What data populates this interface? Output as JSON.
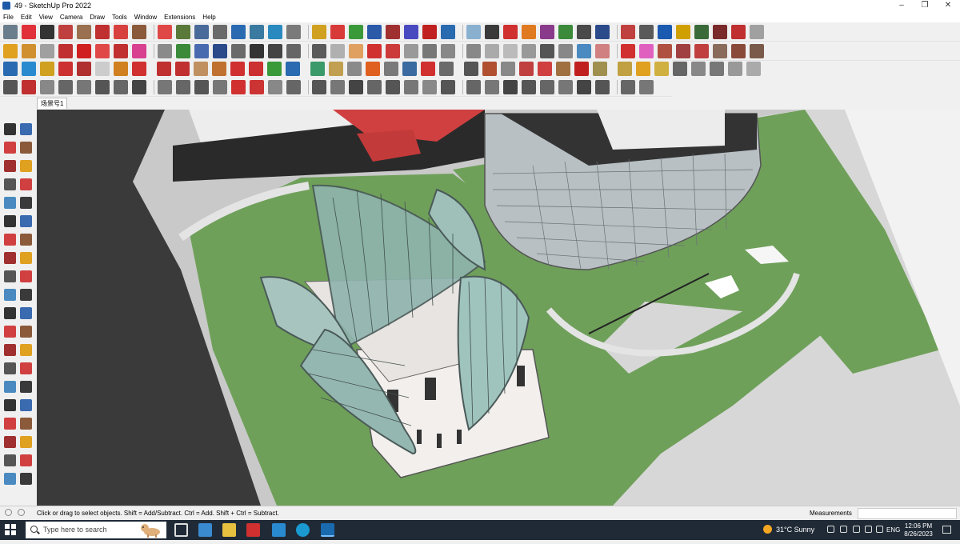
{
  "window": {
    "title": "49 - SketchUp Pro 2022",
    "minimize_glyph": "–",
    "maximize_glyph": "❐",
    "close_glyph": "✕"
  },
  "menu": [
    "File",
    "Edit",
    "View",
    "Camera",
    "Draw",
    "Tools",
    "Window",
    "Extensions",
    "Help"
  ],
  "scene_tab": "场景号1",
  "toolbar_rows": [
    {
      "count": 40,
      "colors": [
        "#6a7d8c",
        "#e0303a",
        "#333333",
        "#c04040",
        "#9a7050",
        "#c03030",
        "#d84040",
        "#8a5a3a",
        "#e04848",
        "#5a7a3a",
        "#4a6a9a",
        "#6a6a6a",
        "#2a6ab0",
        "#3a7aa0",
        "#2a8ac0",
        "#7a7a7a",
        "#d0a020",
        "#d83a3a",
        "#3a9a3a",
        "#2a5aa8",
        "#a03030",
        "#4a4ac0",
        "#c02020",
        "#2a6ab0",
        "#8ab0d0",
        "#3a3a3a",
        "#d03030",
        "#e07a20",
        "#8a3a8a",
        "#3a8a3a",
        "#4a4a4a",
        "#2a4a8a",
        "#c04040",
        "#5a5a5a",
        "#1a5ab0",
        "#d0a000",
        "#3a6a3a",
        "#7a2a2a",
        "#c03030",
        "#a0a0a0"
      ]
    },
    {
      "count": 40,
      "colors": [
        "#e0a020",
        "#d09030",
        "#a0a0a0",
        "#c03030",
        "#d02020",
        "#e04848",
        "#c03030",
        "#d84090",
        "#8a8a8a",
        "#3a8a3a",
        "#4a6ab0",
        "#2a4a8a",
        "#6a6a6a",
        "#333333",
        "#444444",
        "#666666",
        "#5a5a5a",
        "#b0b0b0",
        "#e0a060",
        "#d03030",
        "#cc3a3a",
        "#999999",
        "#777777",
        "#888888",
        "#888888",
        "#aaaaaa",
        "#bbbbbb",
        "#999999",
        "#555555",
        "#888888",
        "#4a8ac0",
        "#d08080",
        "#d03030",
        "#e060c0",
        "#b05040",
        "#a04040",
        "#c04040",
        "#8a6a5a",
        "#8a4a3a",
        "#7a5a4a"
      ]
    },
    {
      "count": 40,
      "colors": [
        "#2a6ab0",
        "#2a8ad0",
        "#d0a020",
        "#cc3030",
        "#b03030",
        "#cccccc",
        "#d08020",
        "#d03030",
        "#c03030",
        "#c03030",
        "#c09060",
        "#c07030",
        "#d03030",
        "#cc3030",
        "#3a9a3a",
        "#2a6ab0",
        "#3a9a6a",
        "#c0a050",
        "#8a8a8a",
        "#e06020",
        "#7a7a7a",
        "#3a6aa0",
        "#d03030",
        "#6a6a6a",
        "#555555",
        "#b05030",
        "#888888",
        "#c04040",
        "#d04040",
        "#a07040",
        "#c02020",
        "#a09050",
        "#c0a040",
        "#e0a020",
        "#d0b040",
        "#666666",
        "#888888",
        "#777777",
        "#999999",
        "#aaaaaa"
      ]
    },
    {
      "count": 34,
      "colors": [
        "#555555",
        "#c03030",
        "#888888",
        "#666666",
        "#777777",
        "#555555",
        "#666666",
        "#444444",
        "#777777",
        "#666666",
        "#555555",
        "#777777",
        "#d03030",
        "#cc3333",
        "#888888",
        "#666666",
        "#555555",
        "#777777",
        "#444444",
        "#666666",
        "#555555",
        "#777777",
        "#888888",
        "#555555",
        "#666666",
        "#777777",
        "#444444",
        "#555555",
        "#666666",
        "#777777",
        "#444444",
        "#555555",
        "#666666",
        "#777777"
      ]
    }
  ],
  "viewport": {
    "sky": "#cfcfcf",
    "lawn": "#6fa05a",
    "paving": "#d9d9d9",
    "road": "#3a3a3a",
    "facade": "#b8c0c4",
    "glass": "#8fb4ae",
    "accent": "#d04040"
  },
  "status": {
    "text": "Click or drag to select objects. Shift = Add/Subtract. Ctrl = Add. Shift + Ctrl = Subtract.",
    "measurements_label": "Measurements",
    "measurements_value": ""
  },
  "taskbar": {
    "search_placeholder": "Type here to search",
    "weather": "31°C  Sunny",
    "language": "ENG",
    "time": "12:06 PM",
    "date": "8/26/2023",
    "apps": [
      "task-view",
      "file-explorer",
      "folder",
      "acrobat",
      "sketchup-layout",
      "edge",
      "sketchup"
    ]
  }
}
